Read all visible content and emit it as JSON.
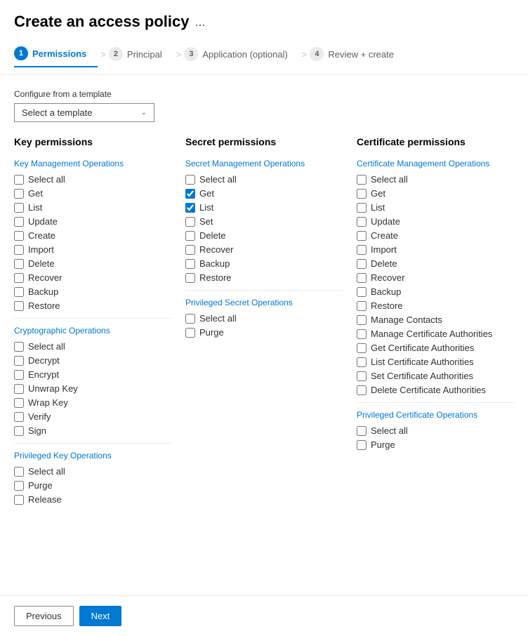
{
  "header": {
    "title": "Create an access policy",
    "ellipsis": "..."
  },
  "wizard": {
    "tabs": [
      {
        "id": "permissions",
        "step": "1",
        "label": "Permissions",
        "active": true
      },
      {
        "id": "principal",
        "step": "2",
        "label": "Principal",
        "active": false
      },
      {
        "id": "application",
        "step": "3",
        "label": "Application (optional)",
        "active": false
      },
      {
        "id": "review",
        "step": "4",
        "label": "Review + create",
        "active": false
      }
    ]
  },
  "template_section": {
    "label": "Configure from a template",
    "dropdown_placeholder": "Select a template"
  },
  "key_permissions": {
    "title": "Key permissions",
    "sections": [
      {
        "subtitle": "Key Management Operations",
        "items": [
          {
            "label": "Select all",
            "checked": false
          },
          {
            "label": "Get",
            "checked": false
          },
          {
            "label": "List",
            "checked": false
          },
          {
            "label": "Update",
            "checked": false
          },
          {
            "label": "Create",
            "checked": false
          },
          {
            "label": "Import",
            "checked": false
          },
          {
            "label": "Delete",
            "checked": false
          },
          {
            "label": "Recover",
            "checked": false
          },
          {
            "label": "Backup",
            "checked": false
          },
          {
            "label": "Restore",
            "checked": false
          }
        ]
      },
      {
        "subtitle": "Cryptographic Operations",
        "items": [
          {
            "label": "Select all",
            "checked": false
          },
          {
            "label": "Decrypt",
            "checked": false
          },
          {
            "label": "Encrypt",
            "checked": false
          },
          {
            "label": "Unwrap Key",
            "checked": false
          },
          {
            "label": "Wrap Key",
            "checked": false
          },
          {
            "label": "Verify",
            "checked": false
          },
          {
            "label": "Sign",
            "checked": false
          }
        ]
      },
      {
        "subtitle": "Privileged Key Operations",
        "items": [
          {
            "label": "Select all",
            "checked": false
          },
          {
            "label": "Purge",
            "checked": false
          },
          {
            "label": "Release",
            "checked": false
          }
        ]
      }
    ]
  },
  "secret_permissions": {
    "title": "Secret permissions",
    "sections": [
      {
        "subtitle": "Secret Management Operations",
        "items": [
          {
            "label": "Select all",
            "checked": false
          },
          {
            "label": "Get",
            "checked": true
          },
          {
            "label": "List",
            "checked": true
          },
          {
            "label": "Set",
            "checked": false
          },
          {
            "label": "Delete",
            "checked": false
          },
          {
            "label": "Recover",
            "checked": false
          },
          {
            "label": "Backup",
            "checked": false
          },
          {
            "label": "Restore",
            "checked": false
          }
        ]
      },
      {
        "subtitle": "Privileged Secret Operations",
        "items": [
          {
            "label": "Select all",
            "checked": false
          },
          {
            "label": "Purge",
            "checked": false
          }
        ]
      }
    ]
  },
  "certificate_permissions": {
    "title": "Certificate permissions",
    "sections": [
      {
        "subtitle": "Certificate Management Operations",
        "items": [
          {
            "label": "Select all",
            "checked": false
          },
          {
            "label": "Get",
            "checked": false
          },
          {
            "label": "List",
            "checked": false
          },
          {
            "label": "Update",
            "checked": false
          },
          {
            "label": "Create",
            "checked": false
          },
          {
            "label": "Import",
            "checked": false
          },
          {
            "label": "Delete",
            "checked": false
          },
          {
            "label": "Recover",
            "checked": false
          },
          {
            "label": "Backup",
            "checked": false
          },
          {
            "label": "Restore",
            "checked": false
          },
          {
            "label": "Manage Contacts",
            "checked": false
          },
          {
            "label": "Manage Certificate Authorities",
            "checked": false
          },
          {
            "label": "Get Certificate Authorities",
            "checked": false
          },
          {
            "label": "List Certificate Authorities",
            "checked": false
          },
          {
            "label": "Set Certificate Authorities",
            "checked": false
          },
          {
            "label": "Delete Certificate Authorities",
            "checked": false
          }
        ]
      },
      {
        "subtitle": "Privileged Certificate Operations",
        "items": [
          {
            "label": "Select all",
            "checked": false
          },
          {
            "label": "Purge",
            "checked": false
          }
        ]
      }
    ]
  },
  "footer": {
    "previous_label": "Previous",
    "next_label": "Next"
  }
}
